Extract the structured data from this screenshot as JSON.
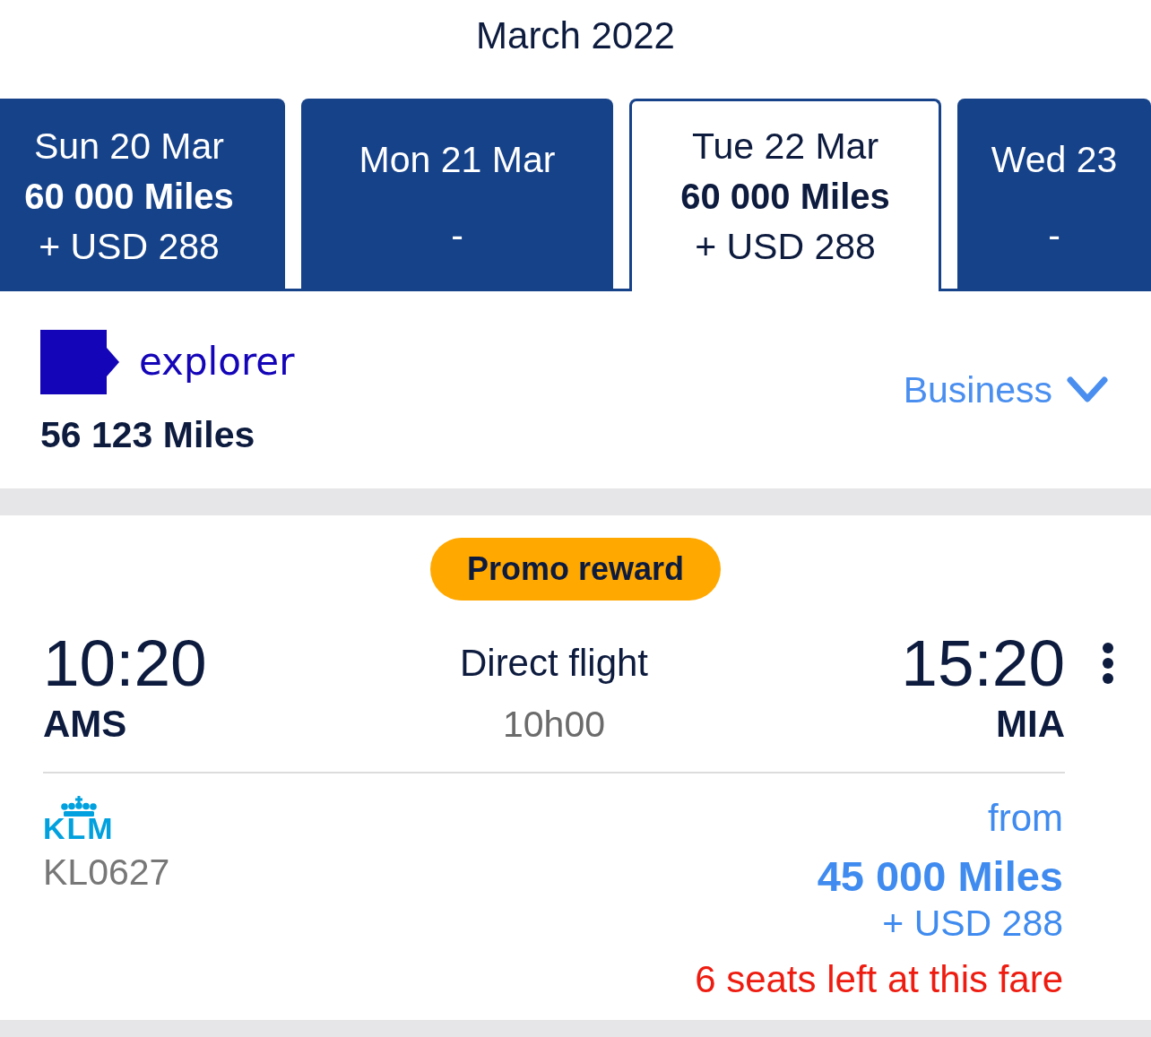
{
  "month_title": "March 2022",
  "date_tabs": [
    {
      "kind": "fare",
      "date": "Sun 20 Mar",
      "miles": "60 000 Miles",
      "price": "+ USD 288",
      "selected": false
    },
    {
      "kind": "no_fare",
      "date": "Mon 21 Mar",
      "fare": "-",
      "selected": false
    },
    {
      "kind": "fare",
      "date": "Tue 22 Mar",
      "miles": "60 000 Miles",
      "price": "+ USD 288",
      "selected": true
    },
    {
      "kind": "no_fare",
      "date": "Wed 23",
      "fare": "-",
      "selected": false
    }
  ],
  "account": {
    "program": "explorer",
    "miles_balance": "56 123 Miles"
  },
  "cabin_selector": {
    "value": "Business"
  },
  "flights": [
    {
      "badge": "Promo reward",
      "departure": {
        "time": "10:20",
        "airport": "AMS"
      },
      "route": {
        "stops": "Direct flight",
        "duration": "10h00"
      },
      "arrival": {
        "time": "15:20",
        "airport": "MIA"
      },
      "airline": "KLM",
      "flight_number": "KL0627",
      "price": {
        "prefix": "from",
        "miles": "45 000 Miles",
        "cash": "+ USD 288"
      },
      "availability": "6 seats left at this fare"
    }
  ]
}
